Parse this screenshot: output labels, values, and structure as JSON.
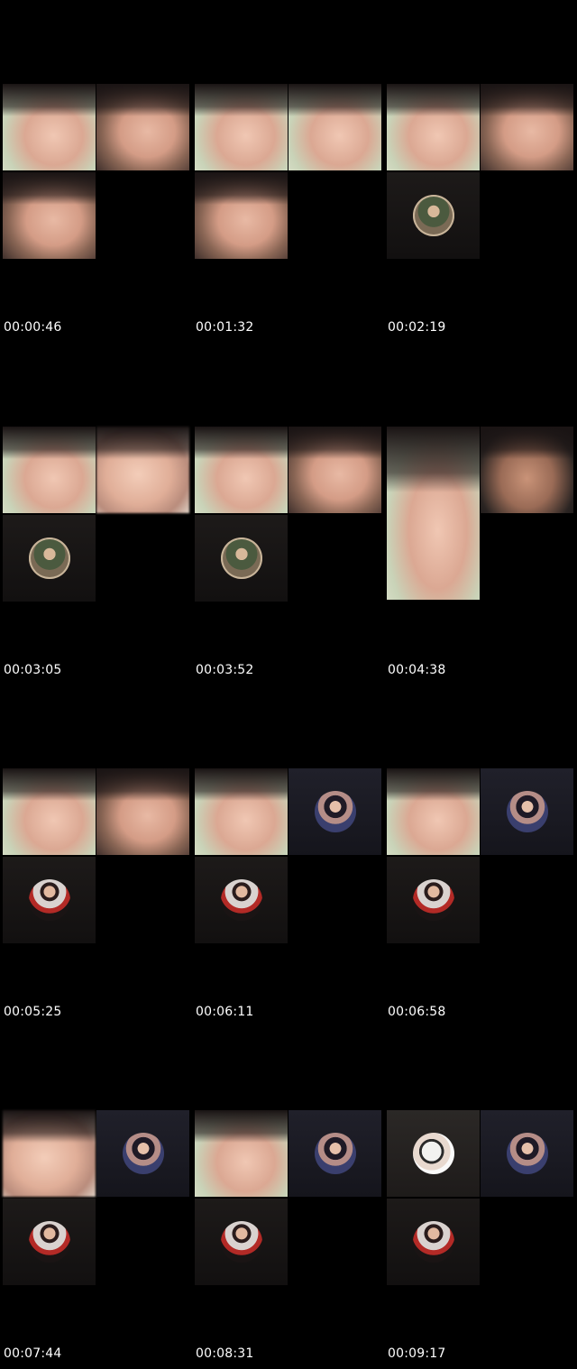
{
  "frames": [
    {
      "timestamp": "00:00:46",
      "tiles": [
        {
          "kind": "camera",
          "style": "light",
          "desc": "person-video"
        },
        {
          "kind": "camera",
          "style": "face",
          "desc": "person-video"
        },
        {
          "kind": "camera",
          "style": "face",
          "desc": "person-video"
        },
        {
          "kind": "empty"
        }
      ]
    },
    {
      "timestamp": "00:01:32",
      "tiles": [
        {
          "kind": "camera",
          "style": "light",
          "desc": "person-video"
        },
        {
          "kind": "camera",
          "style": "light",
          "desc": "person-video"
        },
        {
          "kind": "camera",
          "style": "face",
          "desc": "person-video"
        },
        {
          "kind": "empty"
        }
      ]
    },
    {
      "timestamp": "00:02:19",
      "tiles": [
        {
          "kind": "camera",
          "style": "light",
          "desc": "person-video"
        },
        {
          "kind": "camera",
          "style": "face",
          "desc": "person-video"
        },
        {
          "kind": "avatar",
          "avatar": "man-avatar"
        },
        {
          "kind": "empty"
        }
      ]
    },
    {
      "timestamp": "00:03:05",
      "tiles": [
        {
          "kind": "camera",
          "style": "light",
          "desc": "person-video"
        },
        {
          "kind": "camera",
          "style": "blur",
          "desc": "person-video"
        },
        {
          "kind": "avatar",
          "avatar": "man-avatar"
        },
        {
          "kind": "empty"
        }
      ]
    },
    {
      "timestamp": "00:03:52",
      "tiles": [
        {
          "kind": "camera",
          "style": "light",
          "desc": "person-video"
        },
        {
          "kind": "camera",
          "style": "face",
          "desc": "person-video"
        },
        {
          "kind": "avatar",
          "avatar": "man-avatar"
        },
        {
          "kind": "empty"
        }
      ]
    },
    {
      "timestamp": "00:04:38",
      "tiles": [
        {
          "kind": "camera-tall",
          "style": "light",
          "desc": "person-video"
        },
        {
          "kind": "camera",
          "style": "dark",
          "desc": "person-video"
        }
      ]
    },
    {
      "timestamp": "00:05:25",
      "tiles": [
        {
          "kind": "camera",
          "style": "light",
          "desc": "person-video"
        },
        {
          "kind": "camera",
          "style": "face",
          "desc": "person-video"
        },
        {
          "kind": "avatar",
          "avatar": "woman-red-avatar"
        },
        {
          "kind": "empty"
        }
      ]
    },
    {
      "timestamp": "00:06:11",
      "tiles": [
        {
          "kind": "camera",
          "style": "light",
          "desc": "person-video"
        },
        {
          "kind": "avatar-navy",
          "avatar": "woman-navy-avatar"
        },
        {
          "kind": "avatar",
          "avatar": "woman-red-avatar"
        },
        {
          "kind": "empty"
        }
      ]
    },
    {
      "timestamp": "00:06:58",
      "tiles": [
        {
          "kind": "camera",
          "style": "light",
          "desc": "person-video"
        },
        {
          "kind": "avatar-navy",
          "avatar": "woman-navy-avatar"
        },
        {
          "kind": "avatar",
          "avatar": "woman-red-avatar"
        },
        {
          "kind": "empty"
        }
      ]
    },
    {
      "timestamp": "00:07:44",
      "tiles": [
        {
          "kind": "camera",
          "style": "blur",
          "desc": "person-video"
        },
        {
          "kind": "avatar-navy",
          "avatar": "woman-navy-avatar"
        },
        {
          "kind": "avatar",
          "avatar": "woman-red-avatar"
        },
        {
          "kind": "empty"
        }
      ]
    },
    {
      "timestamp": "00:08:31",
      "tiles": [
        {
          "kind": "camera",
          "style": "light",
          "desc": "person-video"
        },
        {
          "kind": "avatar-navy",
          "avatar": "woman-navy-avatar"
        },
        {
          "kind": "avatar",
          "avatar": "woman-red-avatar"
        },
        {
          "kind": "empty"
        }
      ]
    },
    {
      "timestamp": "00:09:17",
      "tiles": [
        {
          "kind": "avatar-sticker",
          "avatar": "sticker-avatar"
        },
        {
          "kind": "avatar-navy",
          "avatar": "woman-navy-avatar"
        },
        {
          "kind": "avatar",
          "avatar": "woman-red-avatar"
        },
        {
          "kind": "empty"
        }
      ]
    }
  ]
}
